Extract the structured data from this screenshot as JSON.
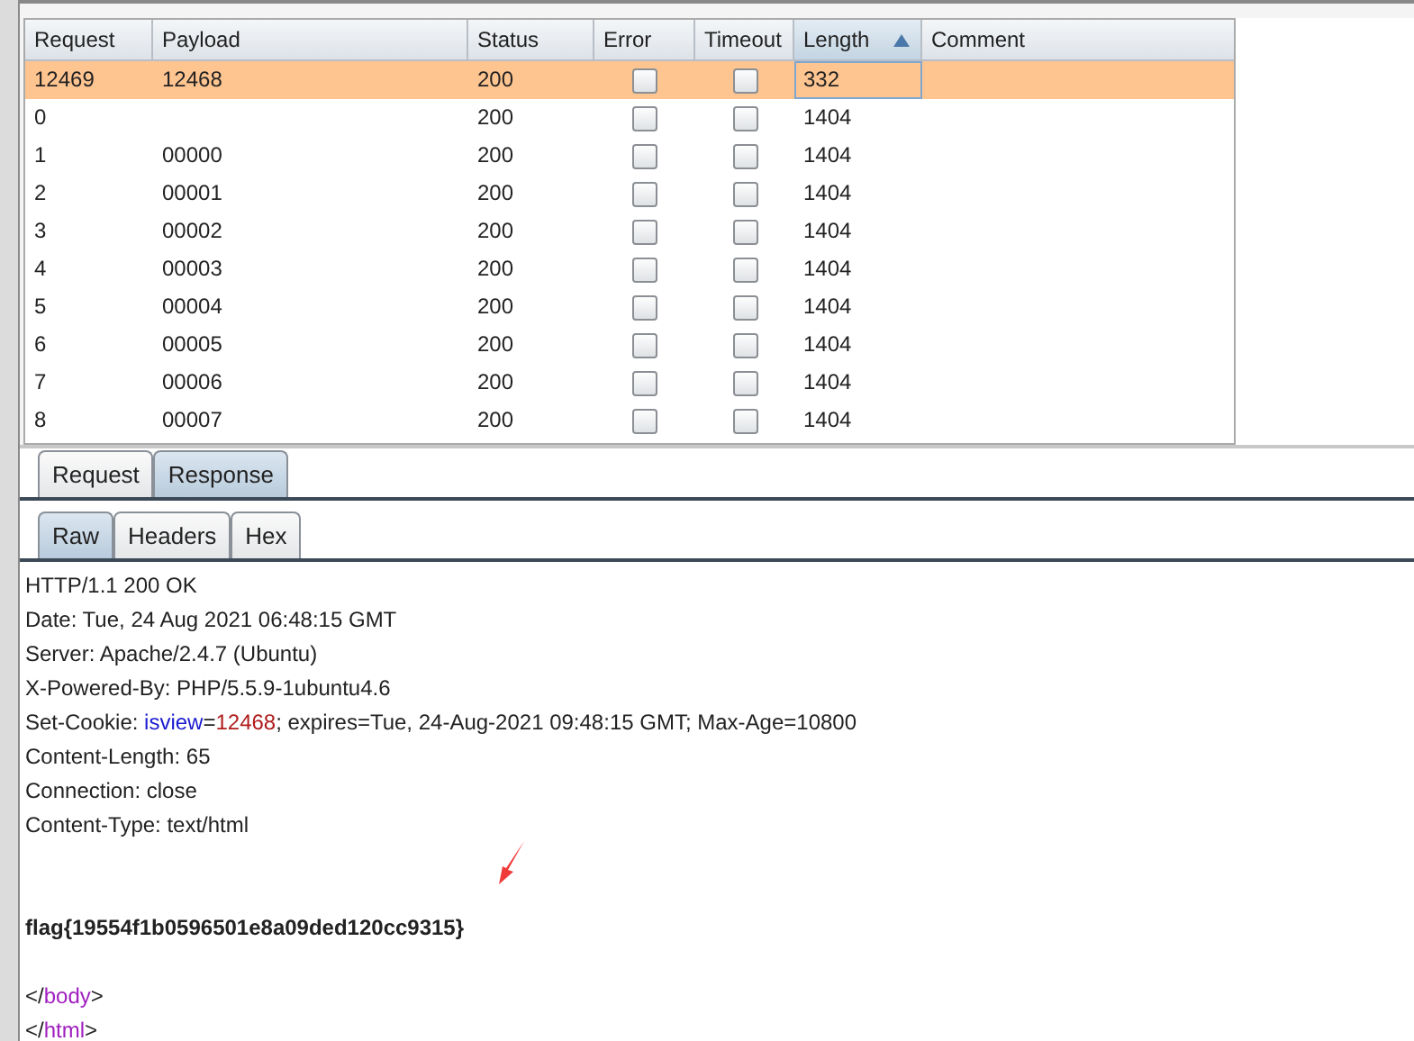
{
  "table": {
    "columns": [
      {
        "label": "Request",
        "sorted": false
      },
      {
        "label": "Payload",
        "sorted": false
      },
      {
        "label": "Status",
        "sorted": false
      },
      {
        "label": "Error",
        "sorted": false
      },
      {
        "label": "Timeout",
        "sorted": false
      },
      {
        "label": "Length",
        "sorted": true
      },
      {
        "label": "Comment",
        "sorted": false
      }
    ],
    "rows": [
      {
        "request": "12469",
        "payload": "12468",
        "status": "200",
        "error": false,
        "timeout": false,
        "length": "332",
        "selected": true
      },
      {
        "request": "0",
        "payload": "",
        "status": "200",
        "error": false,
        "timeout": false,
        "length": "1404",
        "selected": false
      },
      {
        "request": "1",
        "payload": "00000",
        "status": "200",
        "error": false,
        "timeout": false,
        "length": "1404",
        "selected": false
      },
      {
        "request": "2",
        "payload": "00001",
        "status": "200",
        "error": false,
        "timeout": false,
        "length": "1404",
        "selected": false
      },
      {
        "request": "3",
        "payload": "00002",
        "status": "200",
        "error": false,
        "timeout": false,
        "length": "1404",
        "selected": false
      },
      {
        "request": "4",
        "payload": "00003",
        "status": "200",
        "error": false,
        "timeout": false,
        "length": "1404",
        "selected": false
      },
      {
        "request": "5",
        "payload": "00004",
        "status": "200",
        "error": false,
        "timeout": false,
        "length": "1404",
        "selected": false
      },
      {
        "request": "6",
        "payload": "00005",
        "status": "200",
        "error": false,
        "timeout": false,
        "length": "1404",
        "selected": false
      },
      {
        "request": "7",
        "payload": "00006",
        "status": "200",
        "error": false,
        "timeout": false,
        "length": "1404",
        "selected": false
      },
      {
        "request": "8",
        "payload": "00007",
        "status": "200",
        "error": false,
        "timeout": false,
        "length": "1404",
        "selected": false
      }
    ]
  },
  "message_tabs": [
    {
      "label": "Request",
      "selected": false
    },
    {
      "label": "Response",
      "selected": true
    }
  ],
  "view_tabs": [
    {
      "label": "Raw",
      "selected": true
    },
    {
      "label": "Headers",
      "selected": false
    },
    {
      "label": "Hex",
      "selected": false
    }
  ],
  "response_lines": [
    {
      "kind": "text",
      "bold": false,
      "parts": [
        {
          "kind": "plain",
          "text": "HTTP/1.1 200 OK"
        }
      ]
    },
    {
      "kind": "text",
      "bold": false,
      "parts": [
        {
          "kind": "plain",
          "text": "Date: Tue, 24 Aug 2021 06:48:15 GMT"
        }
      ]
    },
    {
      "kind": "text",
      "bold": false,
      "parts": [
        {
          "kind": "plain",
          "text": "Server: Apache/2.4.7 (Ubuntu)"
        }
      ]
    },
    {
      "kind": "text",
      "bold": false,
      "parts": [
        {
          "kind": "plain",
          "text": "X-Powered-By: PHP/5.5.9-1ubuntu4.6"
        }
      ]
    },
    {
      "kind": "text",
      "bold": false,
      "parts": [
        {
          "kind": "plain",
          "text": "Set-Cookie: "
        },
        {
          "kind": "name",
          "text": "isview"
        },
        {
          "kind": "plain",
          "text": "="
        },
        {
          "kind": "value",
          "text": "12468"
        },
        {
          "kind": "plain",
          "text": "; expires=Tue, 24-Aug-2021 09:48:15 GMT; Max-Age=10800"
        }
      ]
    },
    {
      "kind": "text",
      "bold": false,
      "parts": [
        {
          "kind": "plain",
          "text": "Content-Length: 65"
        }
      ]
    },
    {
      "kind": "text",
      "bold": false,
      "parts": [
        {
          "kind": "plain",
          "text": "Connection: close"
        }
      ]
    },
    {
      "kind": "text",
      "bold": false,
      "parts": [
        {
          "kind": "plain",
          "text": "Content-Type: text/html"
        }
      ]
    },
    {
      "kind": "blank"
    },
    {
      "kind": "blank"
    },
    {
      "kind": "text",
      "bold": true,
      "parts": [
        {
          "kind": "plain",
          "text": "flag{19554f1b0596501e8a09ded120cc9315}"
        }
      ]
    },
    {
      "kind": "blank"
    },
    {
      "kind": "text",
      "bold": false,
      "parts": [
        {
          "kind": "plain",
          "text": "</"
        },
        {
          "kind": "tag",
          "text": "body"
        },
        {
          "kind": "plain",
          "text": ">"
        }
      ]
    },
    {
      "kind": "text",
      "bold": false,
      "parts": [
        {
          "kind": "plain",
          "text": "</"
        },
        {
          "kind": "tag",
          "text": "html"
        },
        {
          "kind": "plain",
          "text": ">"
        }
      ]
    }
  ]
}
